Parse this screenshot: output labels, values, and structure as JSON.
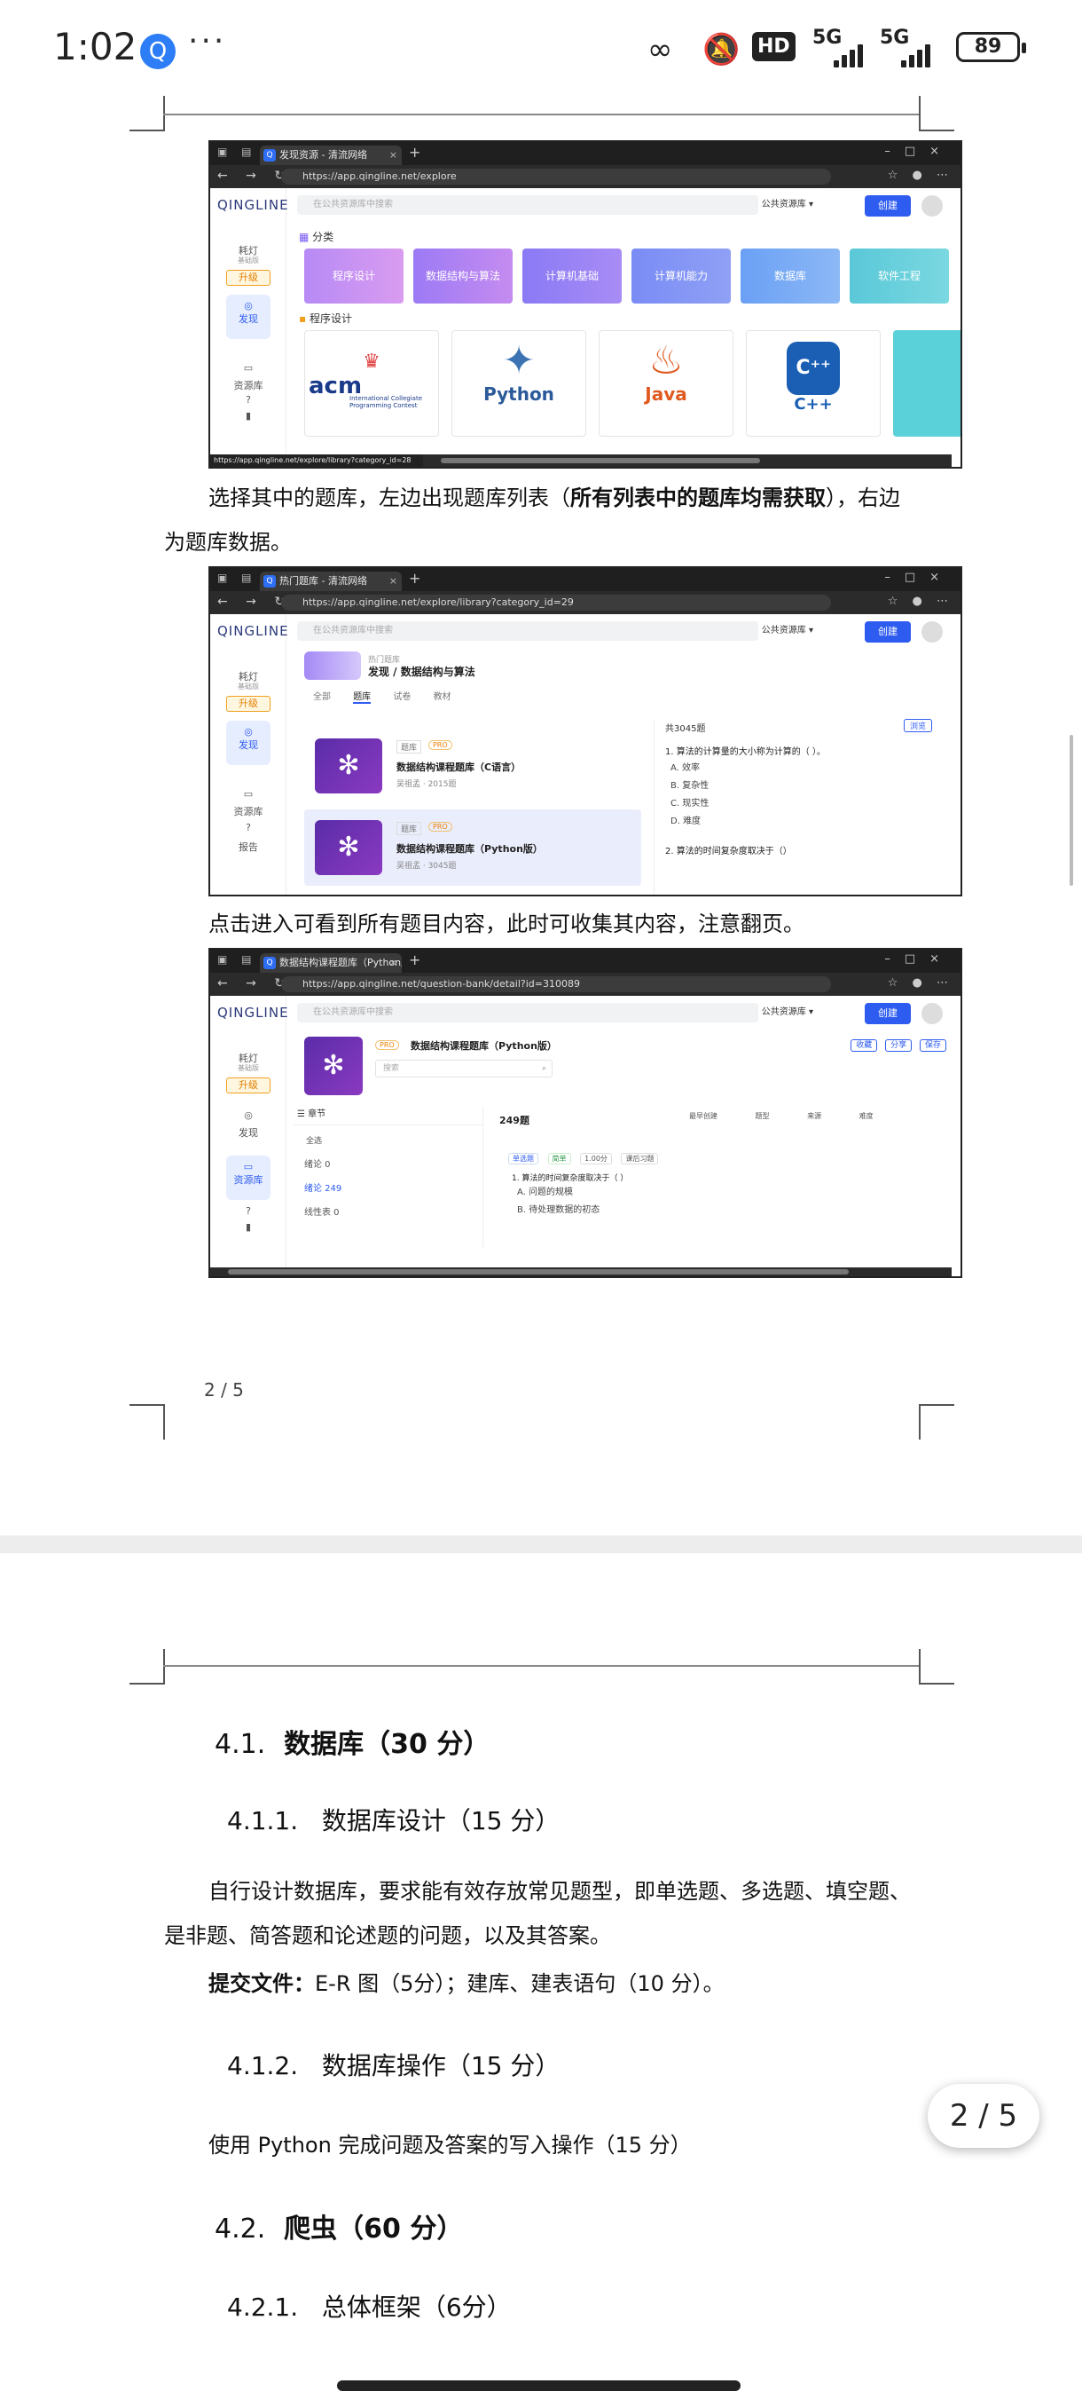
{
  "status_bar": {
    "time": "1:02",
    "more": "···",
    "hd": "HD",
    "net1": "5G",
    "net2": "5G",
    "battery": "89"
  },
  "doc": {
    "para1_a": "选择其中的题库，左边出现题库列表（",
    "para1_bold": "所有列表中的题库均需获取",
    "para1_b": "），右边",
    "para1_line2": "为题库数据。",
    "para2": "点击进入可看到所有题目内容，此时可收集其内容，注意翻页。",
    "page_footer": "2 / 5",
    "h41_num": "4.1.",
    "h41_title": "数据库（30 分）",
    "h411_num": "4.1.1.",
    "h411_title": "数据库设计（15 分）",
    "para3_line1": "自行设计数据库，要求能有效存放常见题型，即单选题、多选题、填空题、",
    "para3_line2": "是非题、简答题和论述题的问题，以及其答案。",
    "submit_label": "提交文件：",
    "submit_text": "E-R 图（5分）；建库、建表语句（10 分）。",
    "h412_num": "4.1.2.",
    "h412_title": "数据库操作（15 分）",
    "para4": "使用 Python 完成问题及答案的写入操作（15 分）",
    "h42_num": "4.2.",
    "h42_title": "爬虫（60 分）",
    "h421_num": "4.2.1.",
    "h421_title": "总体框架（6分）"
  },
  "page_indicator": "2 / 5",
  "shot1": {
    "tab": "发现资源 - 清流网络",
    "url": "https://app.qingline.net/explore",
    "logo": "QINGLINE",
    "search": "在公共资源库中搜索",
    "pub": "公共资源库 ▾",
    "create": "创建",
    "side_light": "耗灯",
    "side_sub": "基础版",
    "side_up": "升级",
    "side_discover": "发现",
    "side_lib": "资源库",
    "help": "?",
    "cat_title": "分类",
    "cats": [
      "程序设计",
      "数据结构与算法",
      "计算机基础",
      "计算机能力",
      "数据库",
      "软件工程"
    ],
    "sub_title": "程序设计",
    "tiles": [
      "acm",
      "Python",
      "Java",
      "C++"
    ],
    "acm_sub": "International Collegiate Programming Contest",
    "status_url": "https://app.qingline.net/explore/library?category_id=28"
  },
  "shot2": {
    "tab": "热门题库 - 清流网络",
    "url": "https://app.qingline.net/explore/library?category_id=29",
    "crumb_small": "热门题库",
    "crumb": "发现 / 数据结构与算法",
    "tabs": [
      "全部",
      "题库",
      "试卷",
      "教材"
    ],
    "item1_tag": "题库",
    "item1_pro": "PRO",
    "item1_title": "数据结构课程题库（C语言）",
    "item1_meta": "吴祖孟 · 2015题",
    "item2_tag": "题库",
    "item2_pro": "PRO",
    "item2_title": "数据结构课程题库（Python版）",
    "item2_meta": "吴祖孟 · 3045题",
    "right_count": "共3045题",
    "browse": "浏览",
    "q1": "1. 算法的计算量的大小称为计算的（   ）。",
    "opts": [
      "A. 效率",
      "B. 复杂性",
      "C. 现实性",
      "D. 难度"
    ],
    "q2": "2. 算法的时间复杂度取决于（）",
    "side_report": "报告"
  },
  "shot3": {
    "tab": "数据结构课程题库（Python版）",
    "url": "https://app.qingline.net/question-bank/detail?id=310089",
    "title": "数据结构课程题库（Python版）",
    "pro": "PRO",
    "btns": [
      "收藏",
      "分享",
      "保存"
    ],
    "search": "搜索",
    "chapter": "章节",
    "chapters": [
      "全选",
      "绪论 0",
      "绪论 249",
      "线性表 0"
    ],
    "count": "249题",
    "filters": [
      "最早创建",
      "题型",
      "来源",
      "难度"
    ],
    "qtype": "单选题",
    "qdiff": "简单",
    "qscore": "1.00分",
    "qsrc": "课后习题",
    "q1": "1. 算法的时间复杂度取决于（ ）",
    "opts": [
      "A. 问题的规模",
      "B. 待处理数据的初态"
    ]
  }
}
